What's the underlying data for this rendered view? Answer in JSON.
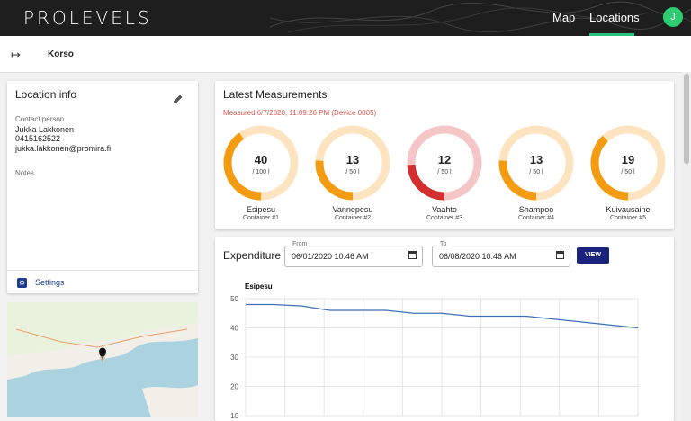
{
  "header": {
    "logo": "PROLEVELS",
    "nav": [
      "Map",
      "Locations"
    ],
    "active_nav": "Locations",
    "avatar_initial": "J",
    "accent_color": "#26c281"
  },
  "subheader": {
    "back_icon": "exit-arrow-icon",
    "location_name": "Korso"
  },
  "location_info": {
    "title": "Location info",
    "contact_label": "Contact person",
    "contact_name": "Jukka Lakkonen",
    "contact_phone": "0415162522",
    "contact_email": "jukka.lakkonen@promira.fi",
    "notes_label": "Notes",
    "settings_label": "Settings"
  },
  "latest": {
    "title": "Latest Measurements",
    "measured": "Measured 6/7/2020, 11:09:26 PM (Device 0005)",
    "gauges": [
      {
        "value": "40",
        "capacity": "/ 100 l",
        "name": "Esipesu",
        "container": "Container #1",
        "fraction": 0.4,
        "color": "#f39c12",
        "track": "#fde3bf"
      },
      {
        "value": "13",
        "capacity": "/ 50 l",
        "name": "Vannepesu",
        "container": "Container #2",
        "fraction": 0.26,
        "color": "#f39c12",
        "track": "#fde3bf"
      },
      {
        "value": "12",
        "capacity": "/ 50 l",
        "name": "Vaahto",
        "container": "Container #3",
        "fraction": 0.24,
        "color": "#d32f2f",
        "track": "#f5c6c6"
      },
      {
        "value": "13",
        "capacity": "/ 50 l",
        "name": "Shampoo",
        "container": "Container #4",
        "fraction": 0.26,
        "color": "#f39c12",
        "track": "#fde3bf"
      },
      {
        "value": "19",
        "capacity": "/ 50 l",
        "name": "Kuivausaine",
        "container": "Container #5",
        "fraction": 0.38,
        "color": "#f39c12",
        "track": "#fde3bf"
      }
    ]
  },
  "expenditure": {
    "title": "Expenditure",
    "from_label": "From",
    "from_value": "06/01/2020 10:46 AM",
    "to_label": "To",
    "to_value": "06/08/2020 10:46 AM",
    "view_label": "VIEW"
  },
  "chart_data": {
    "type": "line",
    "title": "Esipesu",
    "xlabel": "",
    "ylabel": "",
    "ylim": [
      10,
      50
    ],
    "yticks": [
      50,
      40,
      30,
      20,
      10
    ],
    "grid": true,
    "series": [
      {
        "values": [
          48,
          48,
          47.5,
          46,
          46,
          46,
          45,
          45,
          44,
          44,
          44,
          43,
          42,
          41,
          40
        ],
        "color": "#3b6fb6"
      }
    ]
  }
}
